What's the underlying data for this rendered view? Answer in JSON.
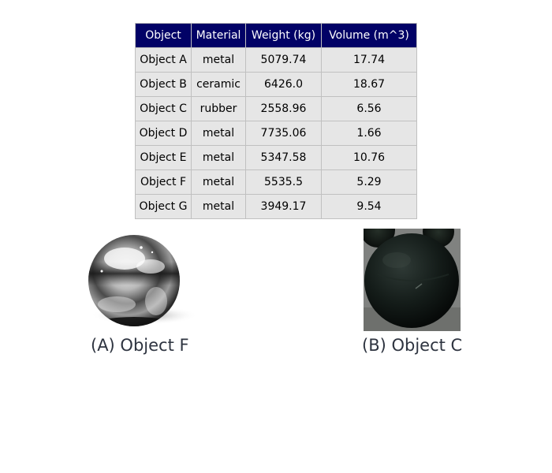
{
  "table": {
    "headers": [
      "Object",
      "Material",
      "Weight (kg)",
      "Volume (m^3)"
    ],
    "rows": [
      [
        "Object A",
        "metal",
        "5079.74",
        "17.74"
      ],
      [
        "Object B",
        "ceramic",
        "6426.0",
        "18.67"
      ],
      [
        "Object C",
        "rubber",
        "2558.96",
        "6.56"
      ],
      [
        "Object D",
        "metal",
        "7735.06",
        "1.66"
      ],
      [
        "Object E",
        "metal",
        "5347.58",
        "10.76"
      ],
      [
        "Object F",
        "metal",
        "5535.5",
        "5.29"
      ],
      [
        "Object G",
        "metal",
        "3949.17",
        "9.54"
      ]
    ]
  },
  "images": {
    "a": {
      "caption": "(A) Object F",
      "subject": "metal-sphere"
    },
    "b": {
      "caption": "(B) Object C",
      "subject": "rubber-ball"
    }
  },
  "colors": {
    "header_bg": "#020266",
    "header_text": "#ffffff",
    "cell_bg": "#e6e6e6",
    "border": "#c0c0c0",
    "caption_text": "#2e3440"
  }
}
